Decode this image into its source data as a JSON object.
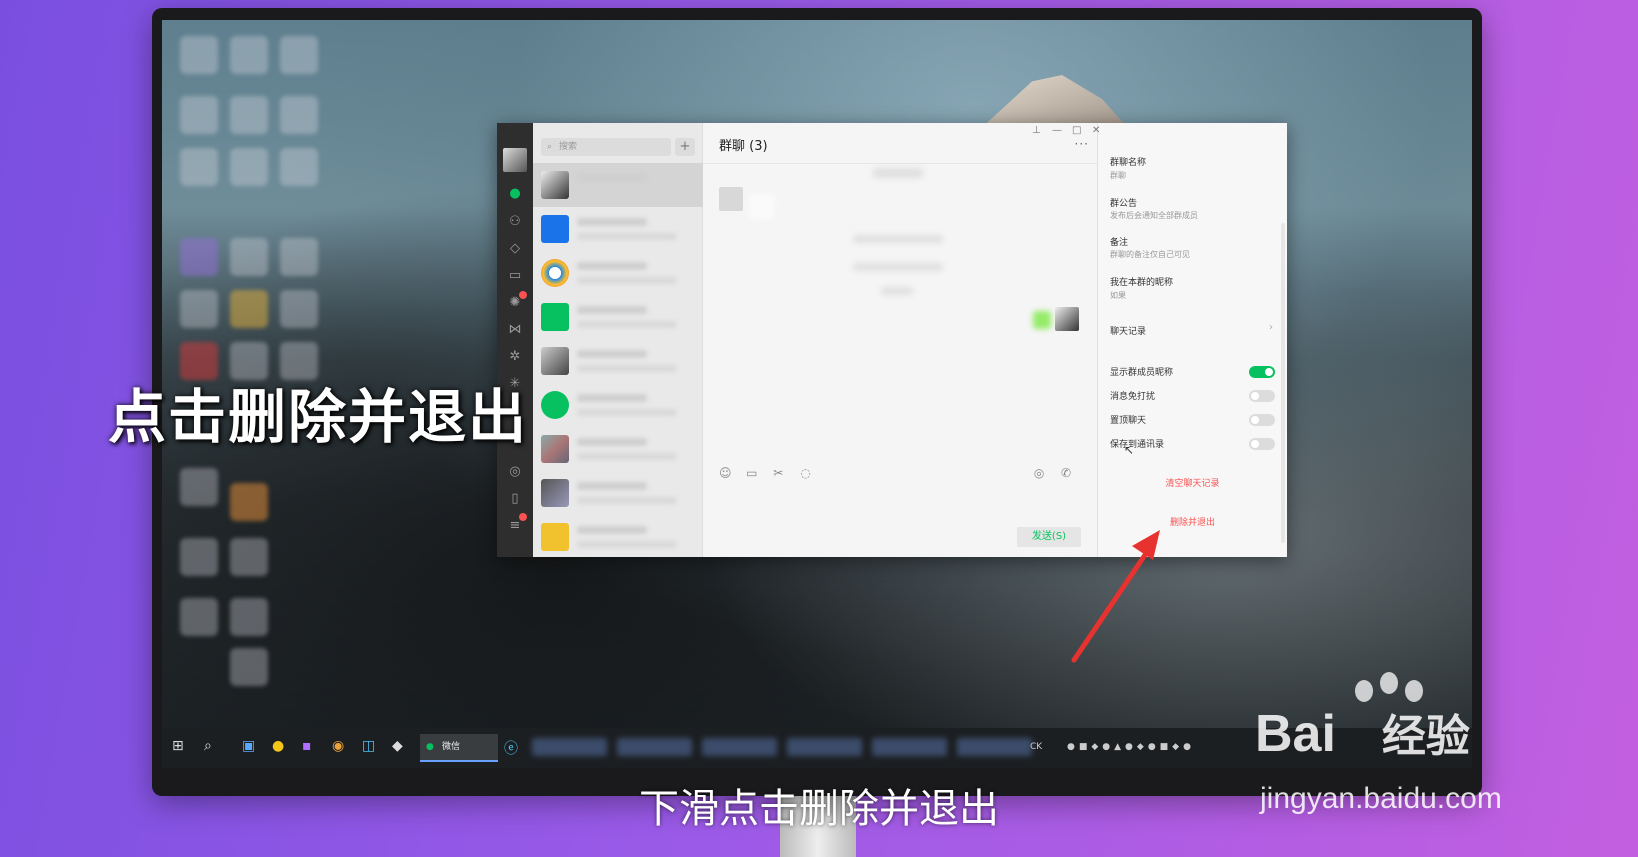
{
  "overlay_caption": "点击删除并退出",
  "subtitle": "下滑点击删除并退出",
  "watermark": {
    "logo_text": "Bai",
    "logo_suffix": "经验",
    "url": "jingyan.baidu.com"
  },
  "wechat": {
    "search_placeholder": "搜索",
    "add_label": "+",
    "chat_title": "群聊 (3)",
    "more_label": "···",
    "send_label": "发送(S)",
    "window_controls": [
      "⊥",
      "—",
      "□",
      "✕"
    ],
    "settings": {
      "group_name_label": "群聊名称",
      "group_name_value": "群聊",
      "announcement_label": "群公告",
      "announcement_value": "发布后会通知全部群成员",
      "remark_label": "备注",
      "remark_value": "群聊的备注仅自己可见",
      "nickname_label": "我在本群的昵称",
      "nickname_value": "如果",
      "history_label": "聊天记录",
      "history_chevron": "›",
      "toggles": [
        {
          "label": "显示群成员昵称",
          "on": true
        },
        {
          "label": "消息免打扰",
          "on": false
        },
        {
          "label": "置顶聊天",
          "on": false
        },
        {
          "label": "保存到通讯录",
          "on": false
        }
      ],
      "clear_history_label": "清空聊天记录",
      "delete_exit_label": "删除并退出"
    }
  },
  "taskbar": {
    "start_icon": "⊞",
    "search_icon": "⌕",
    "active_app_label": "微信",
    "tray_lang": "CK"
  },
  "colors": {
    "accent_green": "#07c160",
    "danger_red": "#fa5151",
    "arrow_red": "#e8322f"
  }
}
